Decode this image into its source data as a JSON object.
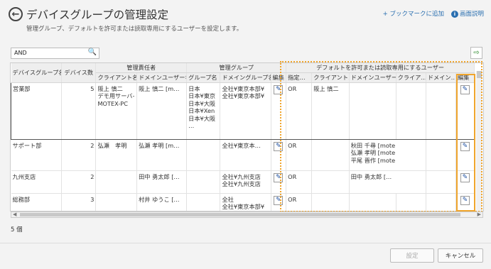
{
  "header": {
    "back_icon": "arrow-left-circle-icon",
    "title": "デバイスグループの管理設定",
    "subtitle": "管理グループ、デフォルトを許可または読取専用にするユーザーを設定します。",
    "bookmark_link": "+ ブックマークに追加",
    "help_link": "画面説明",
    "help_icon": "info-icon"
  },
  "toolbar": {
    "search_value": "AND",
    "search_icon": "search-icon",
    "export_icon": "export-icon"
  },
  "table": {
    "group_headers": {
      "manager": "管理責任者",
      "managed_group": "管理グループ",
      "default_users": "デフォルトを許可または読取専用にするユーザー"
    },
    "columns": {
      "device_group": "デバイスグループ名",
      "device_count": "デバイス数",
      "client_name": "クライアント名",
      "domain_user": "ドメインユーザー名",
      "group_name": "グループ名",
      "domain_group": "ドメイングループ名",
      "edit1": "編集",
      "designation": "指定…",
      "client2": "クライアント…",
      "domain_user2": "ドメインユーザー…",
      "client3": "クライア…",
      "domain3": "ドメイン…",
      "edit2": "編集"
    },
    "rows": [
      {
        "name": "営業部",
        "count": "5",
        "client": [
          "阪上 慎二",
          "デモ用サーバ-",
          "MOTEX-PC"
        ],
        "domain_user": [
          "阪上 慎二 [m…"
        ],
        "group": [
          "日本",
          "日本¥東京",
          "日本¥大阪",
          "日本¥Xen",
          "日本¥大阪",
          "…"
        ],
        "domain_group": [
          "全社¥東京本部¥",
          "全社¥東京本部¥"
        ],
        "designation": "OR",
        "client2": [
          "阪上 慎二"
        ],
        "domain_user2": [],
        "client3": [],
        "domain3": []
      },
      {
        "name": "サポート部",
        "count": "2",
        "client": [
          "弘瀬　孝明"
        ],
        "domain_user": [
          "弘瀬 孝明 [m…"
        ],
        "group": [],
        "domain_group": [
          "全社¥東京本…"
        ],
        "designation": "OR",
        "client2": [],
        "domain_user2": [
          "秋田 千尋 [mote",
          "弘瀬 孝明 [mote",
          "平尾 晋作 [mote"
        ],
        "client3": [],
        "domain3": []
      },
      {
        "name": "九州支店",
        "count": "2",
        "client": [],
        "domain_user": [
          "田中 勇太郎 […"
        ],
        "group": [],
        "domain_group": [
          "全社¥九州支店",
          "全社¥九州支店"
        ],
        "designation": "OR",
        "client2": [],
        "domain_user2": [
          "田中 勇太郎 […"
        ],
        "client3": [],
        "domain3": []
      },
      {
        "name": "総務部",
        "count": "3",
        "client": [],
        "domain_user": [
          "村井 ゆうこ […"
        ],
        "group": [],
        "domain_group": [
          "全社",
          "全社¥東京本部¥"
        ],
        "designation": "OR",
        "client2": [],
        "domain_user2": [],
        "client3": [],
        "domain3": []
      }
    ],
    "edit_icon": "pencil-icon"
  },
  "footer": {
    "count_label": "5 個",
    "save_label": "設定",
    "cancel_label": "キャンセル"
  },
  "colors": {
    "highlight": "#f0a52c",
    "link": "#2a6fb0"
  }
}
